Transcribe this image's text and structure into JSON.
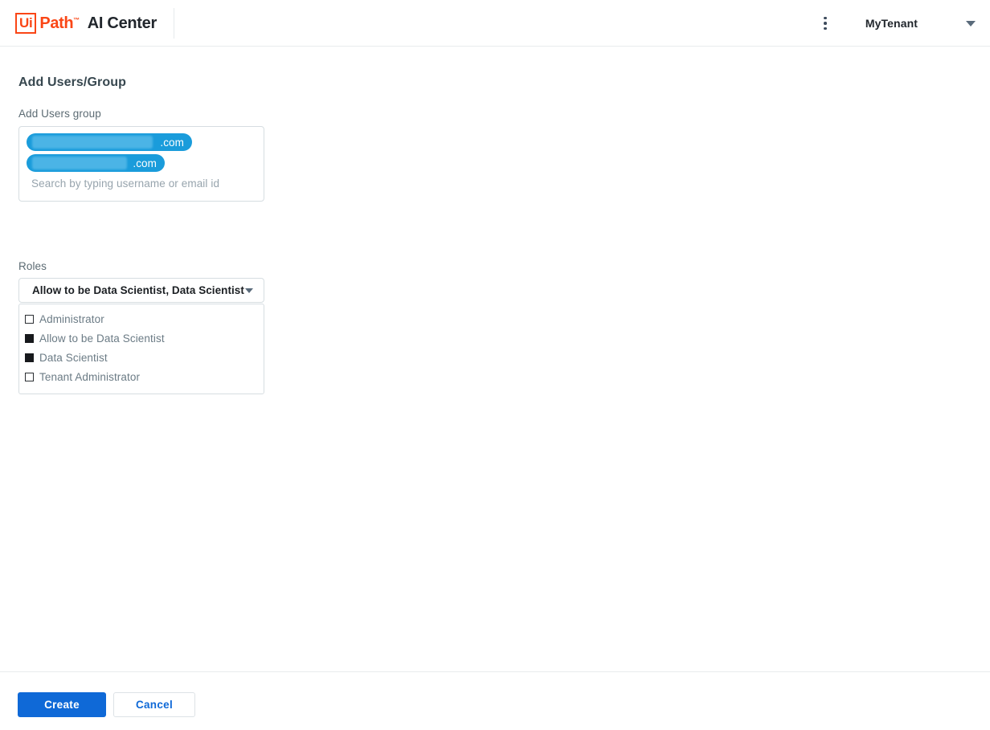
{
  "header": {
    "logo": {
      "badge_text": "Ui",
      "word_text": "Path",
      "tm": "™"
    },
    "app_name": "AI Center",
    "kebab_icon": "more-vertical-icon",
    "tenant_name": "MyTenant",
    "tenant_caret_icon": "chevron-down-icon"
  },
  "form": {
    "title": "Add Users/Group",
    "users": {
      "label": "Add Users group",
      "placeholder": "Search by typing username or email id",
      "chips": [
        {
          "suffix": ".com",
          "redacted": true
        },
        {
          "suffix": ".com",
          "redacted": true
        }
      ]
    },
    "roles": {
      "label": "Roles",
      "selected_value": "Allow to be Data Scientist, Data Scientist",
      "caret_icon": "chevron-down-icon",
      "options": [
        {
          "label": "Administrator",
          "checked": false
        },
        {
          "label": "Allow to be Data Scientist",
          "checked": true
        },
        {
          "label": "Data Scientist",
          "checked": true
        },
        {
          "label": "Tenant Administrator",
          "checked": false
        }
      ]
    }
  },
  "footer": {
    "create_label": "Create",
    "cancel_label": "Cancel"
  },
  "colors": {
    "brand_orange": "#fa4616",
    "primary_blue": "#0f69d7",
    "chip_blue": "#1a9cdb",
    "title_slate": "#37474f",
    "label_gray": "#5c6b73",
    "border_gray": "#d6dde1"
  }
}
